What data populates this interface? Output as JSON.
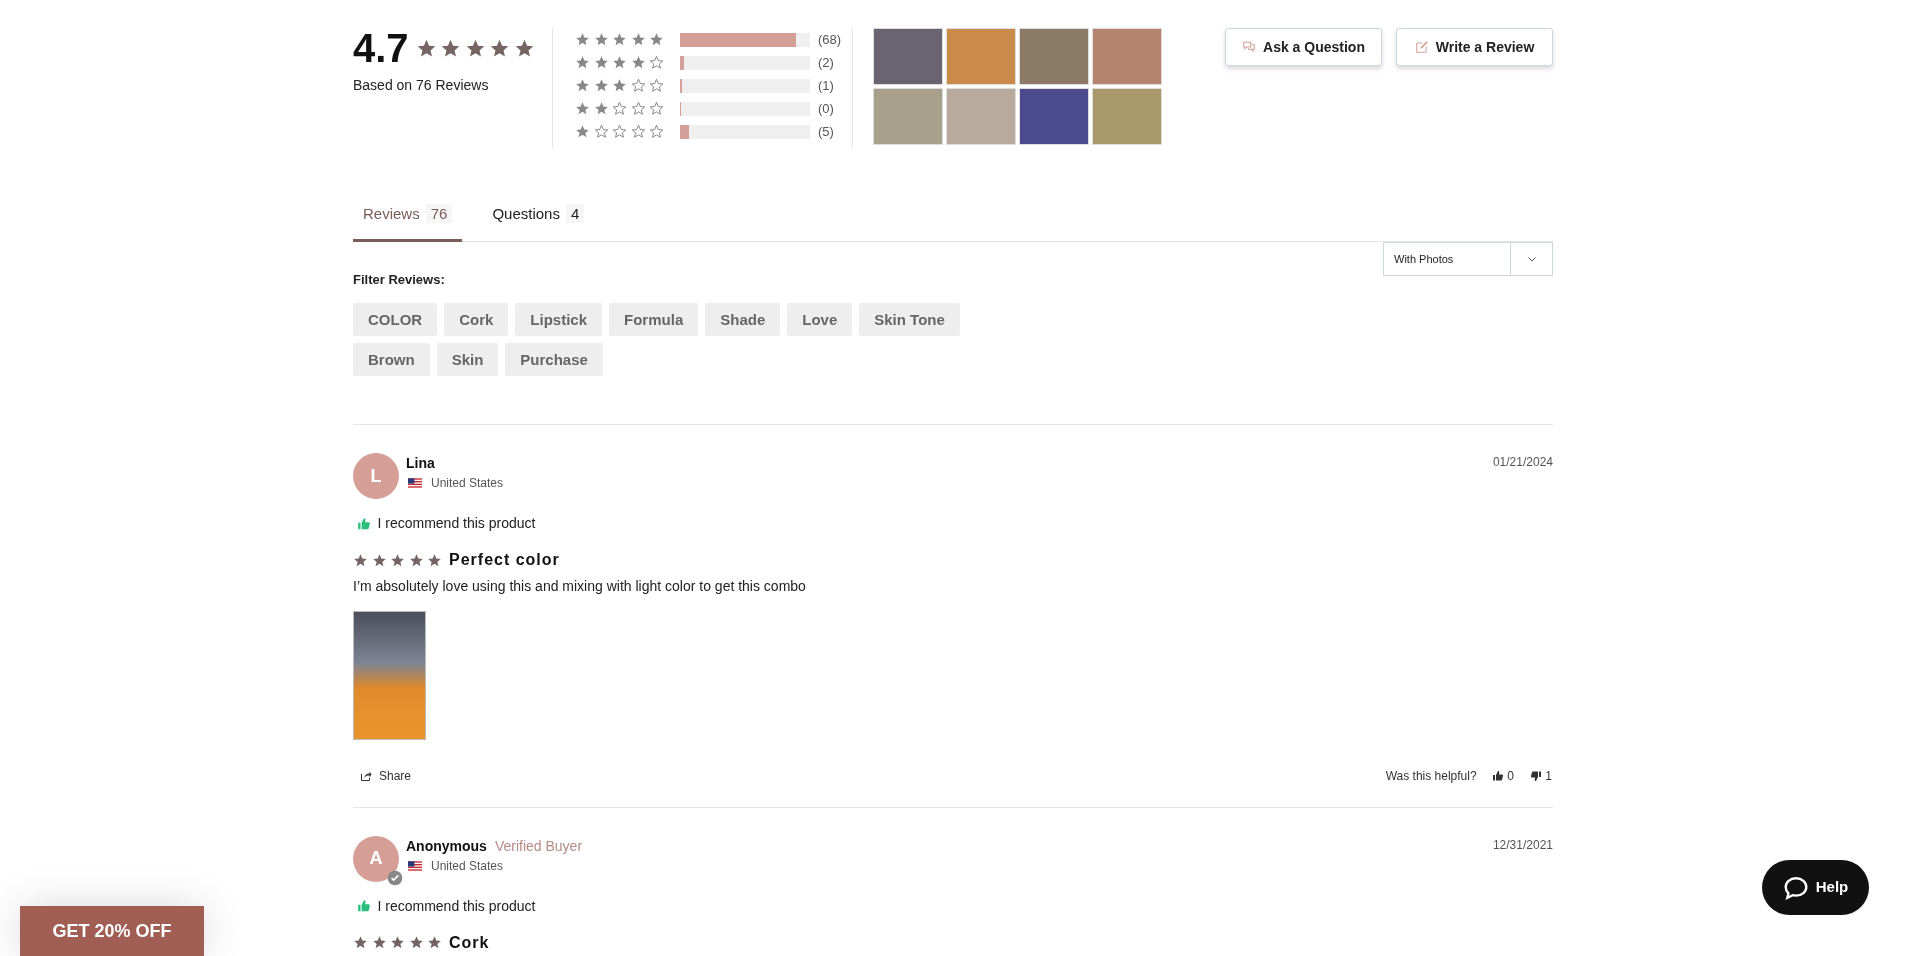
{
  "summary": {
    "rating": "4.7",
    "stars": 5,
    "based_on": "Based on 76 Reviews"
  },
  "histogram": [
    {
      "stars": 5,
      "level": 0.89,
      "count": "(68)"
    },
    {
      "stars": 4,
      "level": 0.03,
      "count": "(2)"
    },
    {
      "stars": 3,
      "level": 0.013,
      "count": "(1)"
    },
    {
      "stars": 2,
      "level": 0,
      "count": "(0)"
    },
    {
      "stars": 1,
      "level": 0.066,
      "count": "(5)"
    }
  ],
  "buttons": [
    {
      "kind": "question",
      "label": "Ask a Question"
    },
    {
      "kind": "write",
      "label": "Write a Review"
    }
  ],
  "tabs": [
    {
      "label": "Reviews",
      "count": "76",
      "selected": true
    },
    {
      "label": "Questions",
      "count": "4",
      "selected": false
    }
  ],
  "filter": {
    "label": "Filter Reviews:",
    "sort_value": "With Photos",
    "tags": [
      "COLOR",
      "Cork",
      "Lipstick",
      "Formula",
      "Shade",
      "Love",
      "Skin Tone",
      "Brown",
      "Skin",
      "Purchase"
    ]
  },
  "reviews": [
    {
      "avatar_letter": "L",
      "name": "Lina",
      "verified": false,
      "country": "United States",
      "date": "01/21/2024",
      "recommend": "I recommend this product",
      "stars": 5,
      "title": "Perfect color",
      "body": "I’m absolutely love using this and mixing with light color to get this combo",
      "has_photo": true,
      "share": "Share",
      "helpful_label": "Was this helpful?",
      "up_votes": "0",
      "down_votes": "1"
    },
    {
      "avatar_letter": "A",
      "name": "Anonymous",
      "verified": true,
      "verified_label": "Verified Buyer",
      "country": "United States",
      "date": "12/31/2021",
      "recommend": "I recommend this product",
      "stars": 5,
      "title": "Cork"
    }
  ],
  "promo": "GET 20% OFF",
  "help": "Help"
}
